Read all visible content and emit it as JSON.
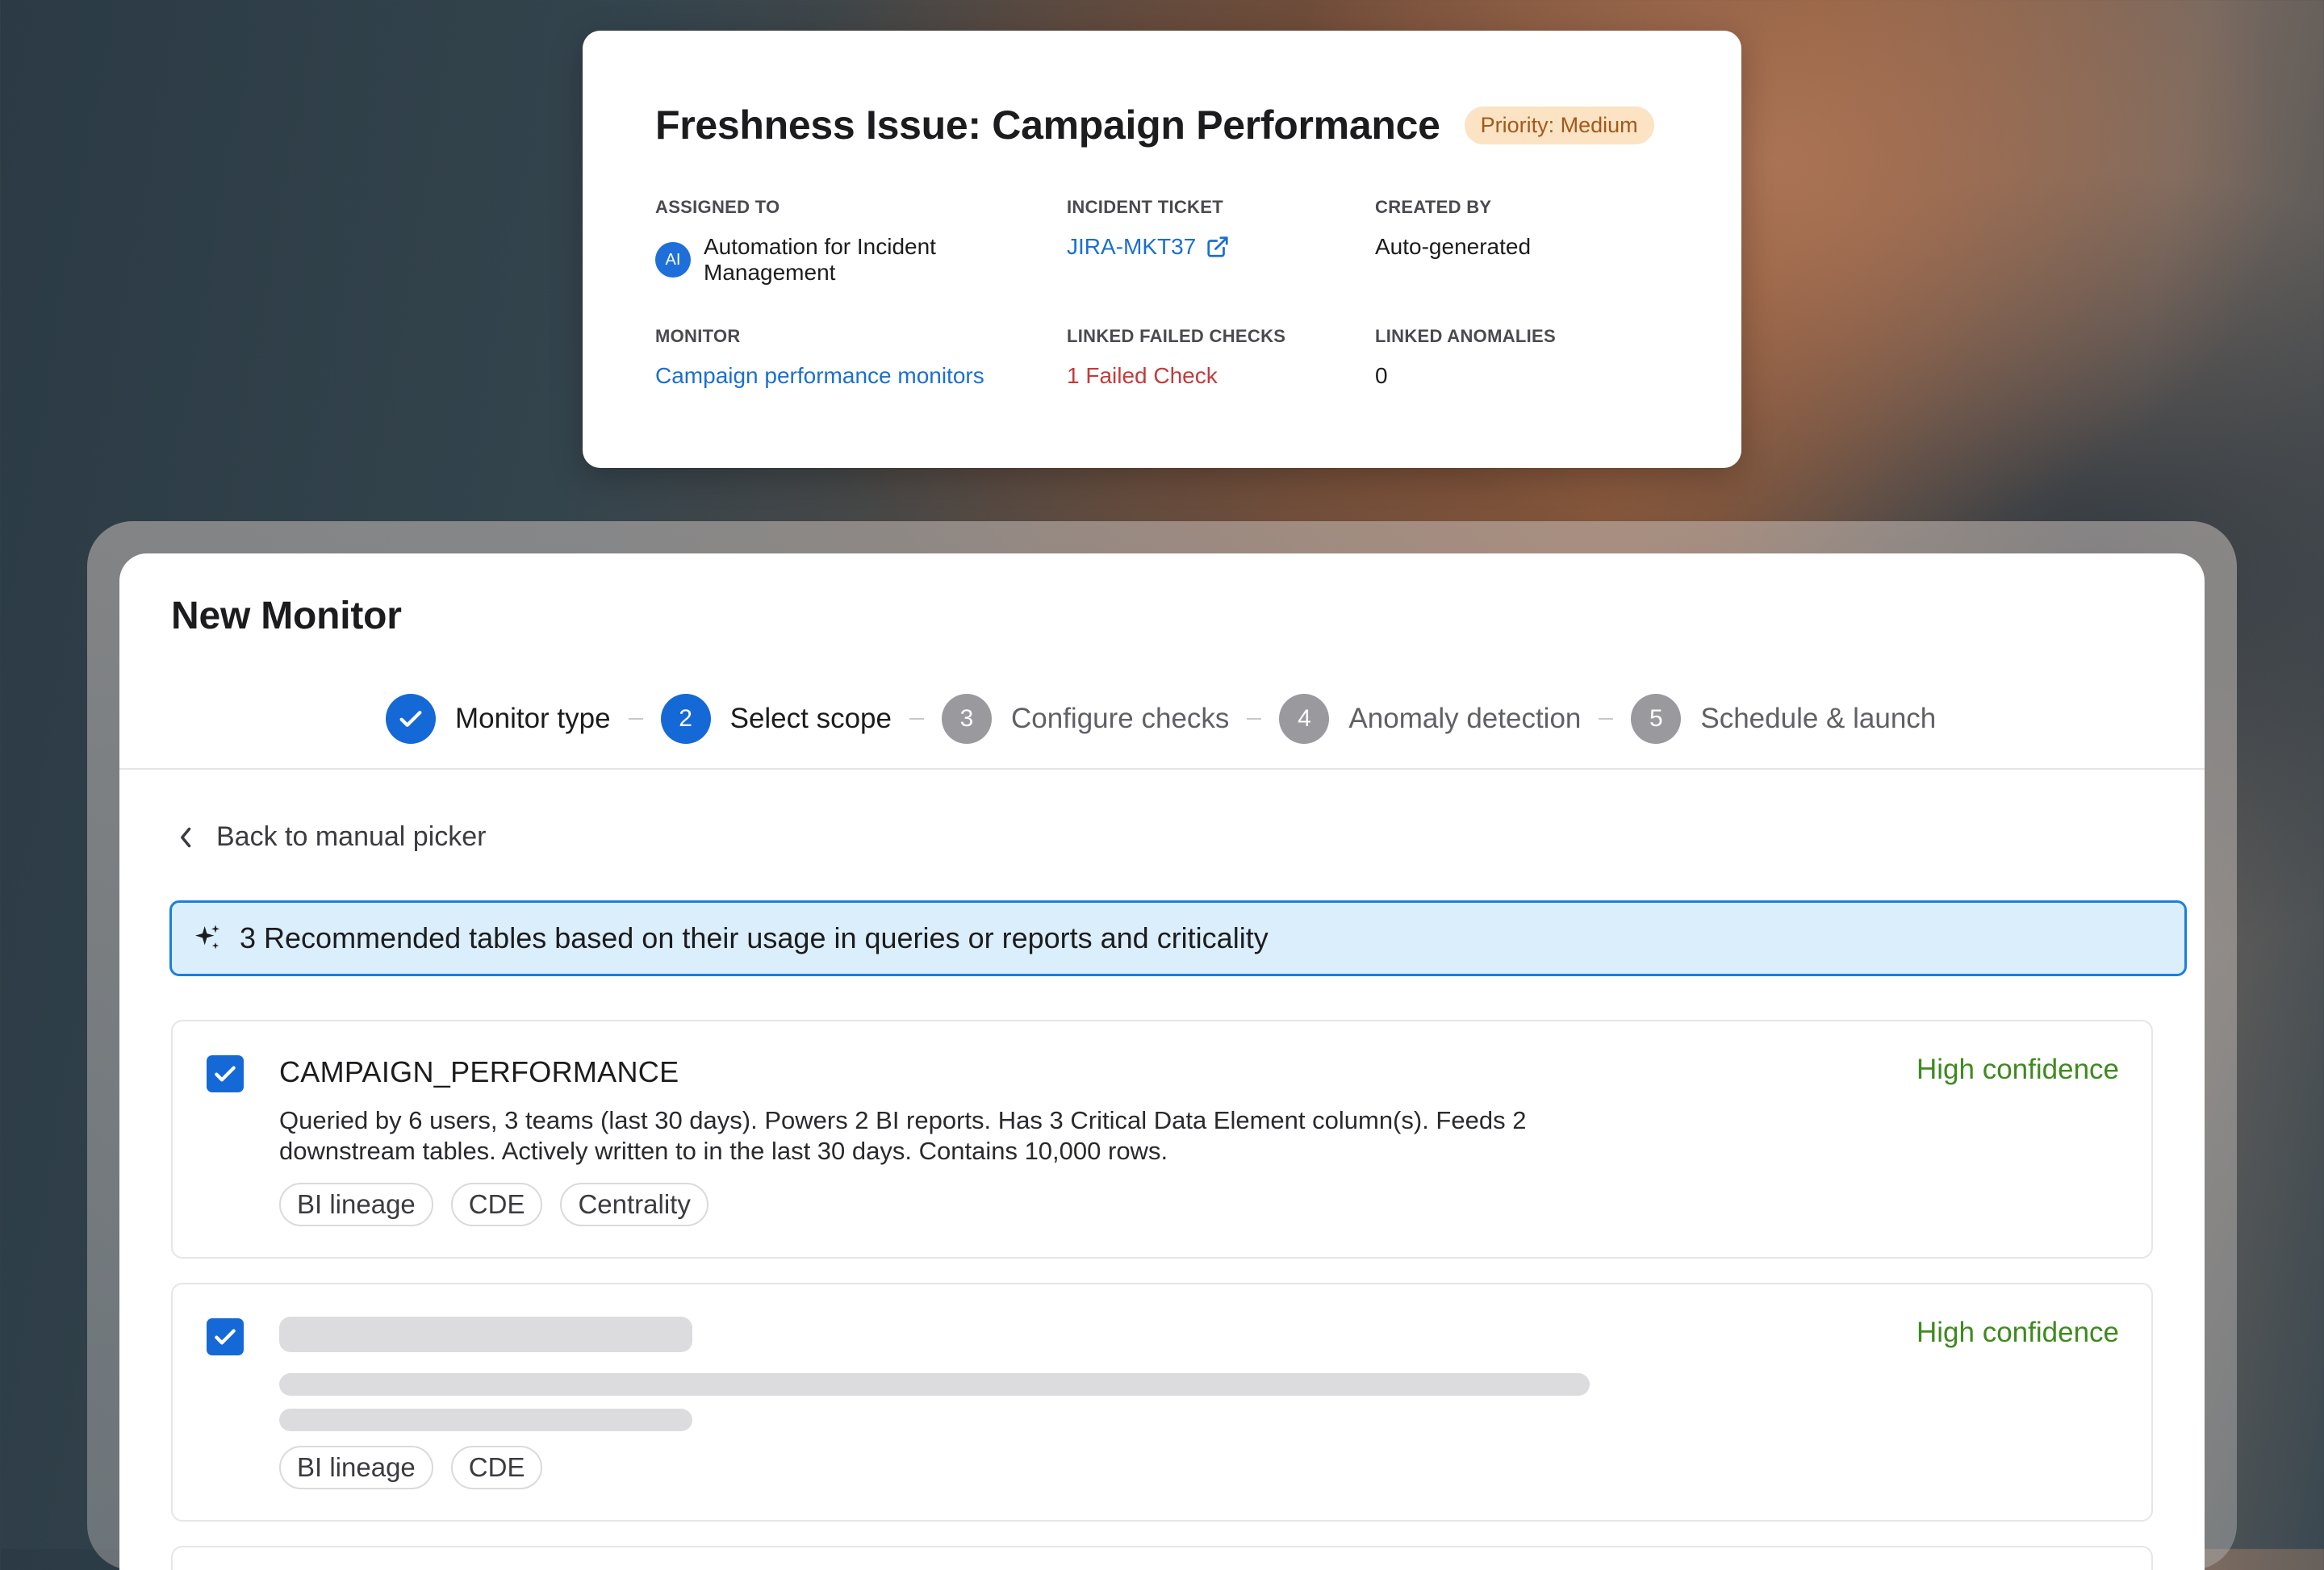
{
  "incident": {
    "title": "Freshness Issue: Campaign Performance",
    "priority": "Priority: Medium",
    "assigned_to_label": "ASSIGNED TO",
    "assignee_avatar": "AI",
    "assignee_name": "Automation for Incident Management",
    "ticket_label": "INCIDENT TICKET",
    "ticket_value": "JIRA-MKT37",
    "created_by_label": "CREATED BY",
    "created_by_value": "Auto-generated",
    "monitor_label": "MONITOR",
    "monitor_value": "Campaign performance monitors",
    "failed_checks_label": "LINKED FAILED CHECKS",
    "failed_checks_value": "1 Failed Check",
    "anomalies_label": "LINKED ANOMALIES",
    "anomalies_value": "0"
  },
  "monitor": {
    "title": "New Monitor",
    "steps": [
      {
        "number": "",
        "label": "Monitor type",
        "state": "done"
      },
      {
        "number": "2",
        "label": "Select scope",
        "state": "active"
      },
      {
        "number": "3",
        "label": "Configure checks",
        "state": "pending"
      },
      {
        "number": "4",
        "label": "Anomaly detection",
        "state": "pending"
      },
      {
        "number": "5",
        "label": "Schedule & launch",
        "state": "pending"
      }
    ],
    "back_label": "Back to manual picker",
    "recommendation_text": "3 Recommended tables based on their usage in queries or reports and criticality",
    "tables": [
      {
        "name": "CAMPAIGN_PERFORMANCE",
        "confidence": "High confidence",
        "description": "Queried by 6 users, 3 teams (last 30 days). Powers 2 BI reports. Has 3 Critical Data Element column(s). Feeds 2 downstream tables. Actively written to in the last 30 days. Contains 10,000 rows.",
        "tags": [
          "BI lineage",
          "CDE",
          "Centrality"
        ]
      },
      {
        "name": "",
        "confidence": "High confidence",
        "description": "",
        "tags": [
          "BI lineage",
          "CDE"
        ]
      }
    ]
  },
  "colors": {
    "accent": "#1569d6",
    "link": "#1b6fd0",
    "danger": "#c43a3a",
    "success": "#3f8a1f",
    "priority_bg": "#fbe3c4"
  },
  "icons": {
    "check": "check-icon",
    "external_link": "external-link-icon",
    "chevron_left": "chevron-left-icon",
    "sparkle": "sparkle-icon"
  }
}
